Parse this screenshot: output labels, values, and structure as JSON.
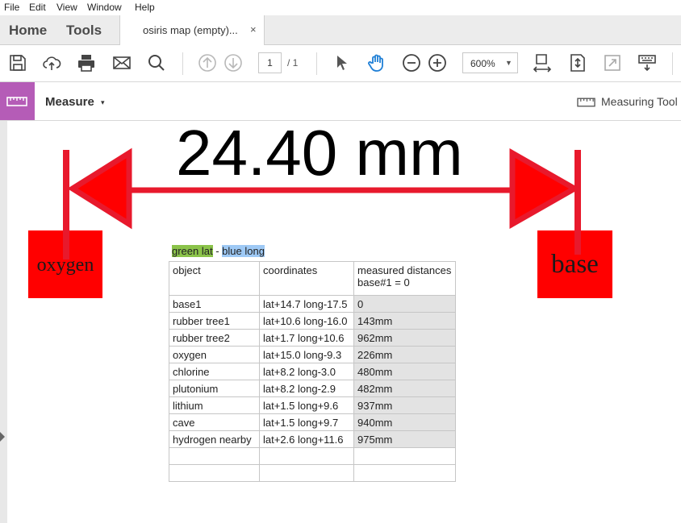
{
  "menu": [
    "File",
    "Edit",
    "View",
    "Window",
    "Help"
  ],
  "tabs": {
    "home": "Home",
    "tools": "Tools",
    "document": "osiris map (empty)...",
    "close": "×"
  },
  "toolbar": {
    "page_current": "1",
    "page_total": "/ 1",
    "zoom": "600%",
    "zoom_caret": "▼"
  },
  "measure_bar": {
    "title": "Measure",
    "caret": "▾",
    "tool_label": "Measuring Tool"
  },
  "document": {
    "measurement": "24.40 mm",
    "left_label": "oxygen",
    "right_label": "base",
    "legend": {
      "green": "green lat",
      "separator": " - ",
      "blue": "blue long"
    },
    "table": {
      "headers": [
        "object",
        "coordinates",
        "measured distances",
        "base#1 = 0"
      ],
      "rows": [
        [
          "base1",
          "lat+14.7 long-17.5",
          "0"
        ],
        [
          "rubber tree1",
          "lat+10.6 long-16.0",
          "143mm"
        ],
        [
          "rubber tree2",
          "lat+1.7 long+10.6",
          "962mm"
        ],
        [
          "oxygen",
          "lat+15.0 long-9.3",
          "226mm"
        ],
        [
          "chlorine",
          "lat+8.2 long-3.0",
          "480mm"
        ],
        [
          "plutonium",
          "lat+8.2 long-2.9",
          "482mm"
        ],
        [
          "lithium",
          "lat+1.5 long+9.6",
          "937mm"
        ],
        [
          "cave",
          "lat+1.5 long+9.7",
          "940mm"
        ],
        [
          "hydrogen nearby",
          "lat+2.6 long+11.6",
          "975mm"
        ],
        [
          "",
          "",
          ""
        ],
        [
          "",
          "",
          ""
        ]
      ]
    },
    "annotation_color": "#e8192c"
  }
}
